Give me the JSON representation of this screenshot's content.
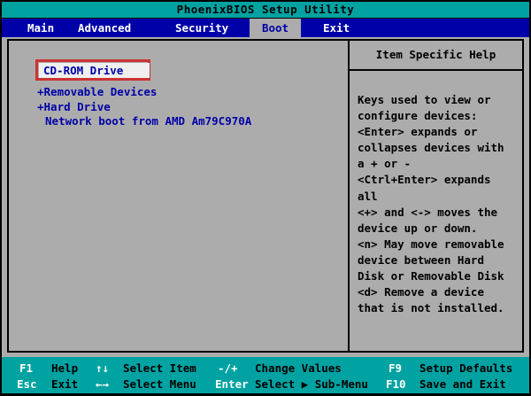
{
  "title": "PhoenixBIOS Setup Utility",
  "menu": {
    "items": [
      {
        "label": "Main",
        "active": false
      },
      {
        "label": "Advanced",
        "active": false
      },
      {
        "label": "Security",
        "active": false
      },
      {
        "label": "Boot",
        "active": true
      },
      {
        "label": "Exit",
        "active": false
      }
    ]
  },
  "boot": {
    "items": [
      "CD-ROM Drive",
      "+Removable Devices",
      "+Hard Drive",
      "Network boot from AMD Am79C970A"
    ],
    "selected_index": 0
  },
  "help": {
    "title": "Item Specific Help",
    "lines": [
      "Keys used to view or",
      "configure devices:",
      "<Enter> expands or",
      "collapses devices with",
      "a + or -",
      "<Ctrl+Enter> expands",
      "all",
      "<+> and <-> moves the",
      "device up or down.",
      "<n> May move removable",
      "device between Hard",
      "Disk or Removable Disk",
      "<d> Remove a device",
      "that is not installed."
    ]
  },
  "legend": {
    "row1": [
      {
        "key": "F1",
        "desc": "Help"
      },
      {
        "key": "↑↓",
        "desc": "Select Item"
      },
      {
        "key": "-/+",
        "desc": "Change Values"
      },
      {
        "key": "F9",
        "desc": "Setup Defaults"
      }
    ],
    "row2": [
      {
        "key": "Esc",
        "desc": "Exit"
      },
      {
        "key": "←→",
        "desc": "Select Menu"
      },
      {
        "key": "Enter",
        "desc": "Select ▶ Sub-Menu"
      },
      {
        "key": "F10",
        "desc": "Save and Exit"
      }
    ]
  },
  "colors": {
    "teal": "#00A2A2",
    "menu_blue": "#0000A8",
    "panel_gray": "#ACACAC",
    "item_text_blue": "#0000A8",
    "selected_item_bg": "#EFEFEF",
    "annotation_red": "#CC3333"
  }
}
